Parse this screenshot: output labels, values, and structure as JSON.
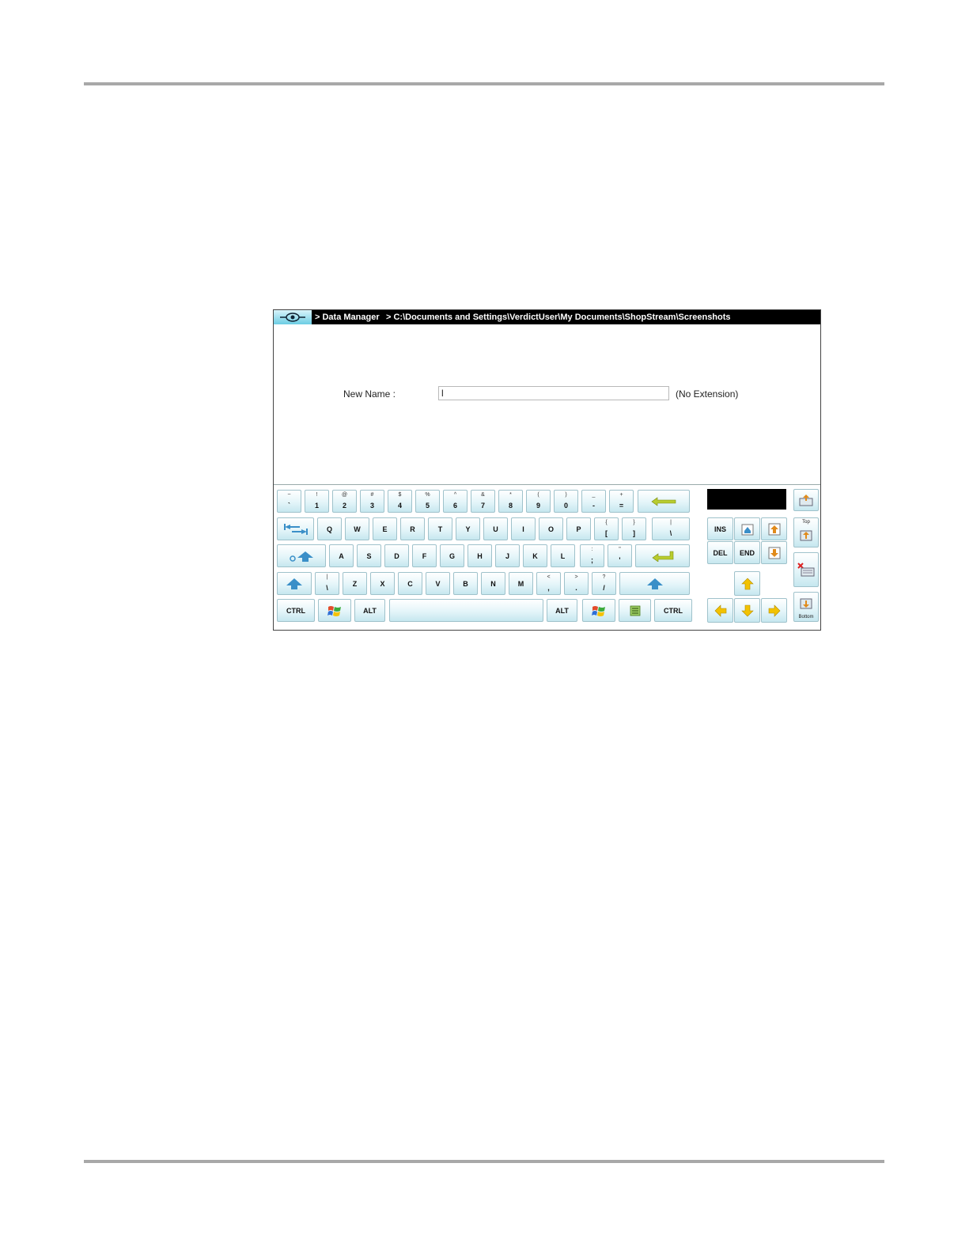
{
  "titlebar": {
    "crumb_data_manager": "> Data Manager",
    "crumb_path": "> C:\\Documents and Settings\\VerdictUser\\My Documents\\ShopStream\\Screenshots"
  },
  "form": {
    "label": "New Name :",
    "value": "l",
    "extension_note": "(No Extension)"
  },
  "keyboard": {
    "row1": [
      {
        "u": "~",
        "l": "`"
      },
      {
        "u": "!",
        "l": "1"
      },
      {
        "u": "@",
        "l": "2"
      },
      {
        "u": "#",
        "l": "3"
      },
      {
        "u": "$",
        "l": "4"
      },
      {
        "u": "%",
        "l": "5"
      },
      {
        "u": "^",
        "l": "6"
      },
      {
        "u": "&",
        "l": "7"
      },
      {
        "u": "*",
        "l": "8"
      },
      {
        "u": "(",
        "l": "9"
      },
      {
        "u": ")",
        "l": "0"
      },
      {
        "u": "_",
        "l": "-"
      },
      {
        "u": "+",
        "l": "="
      }
    ],
    "row2": [
      "Q",
      "W",
      "E",
      "R",
      "T",
      "Y",
      "U",
      "I",
      "O",
      "P"
    ],
    "row2_sym": [
      {
        "u": "{",
        "l": "["
      },
      {
        "u": "}",
        "l": "]"
      },
      {
        "u": "|",
        "l": "\\"
      }
    ],
    "row3": [
      "A",
      "S",
      "D",
      "F",
      "G",
      "H",
      "J",
      "K",
      "L"
    ],
    "row3_sym": [
      {
        "u": ":",
        "l": ";"
      },
      {
        "u": "\"",
        "l": "'"
      }
    ],
    "row4_sym_left": {
      "u": "|",
      "l": "\\"
    },
    "row4": [
      "Z",
      "X",
      "C",
      "V",
      "B",
      "N",
      "M"
    ],
    "row4_sym": [
      {
        "u": "<",
        "l": ","
      },
      {
        "u": ">",
        "l": "."
      },
      {
        "u": "?",
        "l": "/"
      }
    ],
    "ctrl": "CTRL",
    "alt": "ALT",
    "ins": "INS",
    "del": "DEL",
    "end": "END",
    "top": "Top",
    "bottom": "Bottom"
  },
  "colors": {
    "key_top": "#ffffff",
    "key_bottom": "#c6e7ef",
    "arrow_blue": "#3a8fc8",
    "arrow_yellow": "#f2c200",
    "arrow_green": "#b8cc2e"
  }
}
